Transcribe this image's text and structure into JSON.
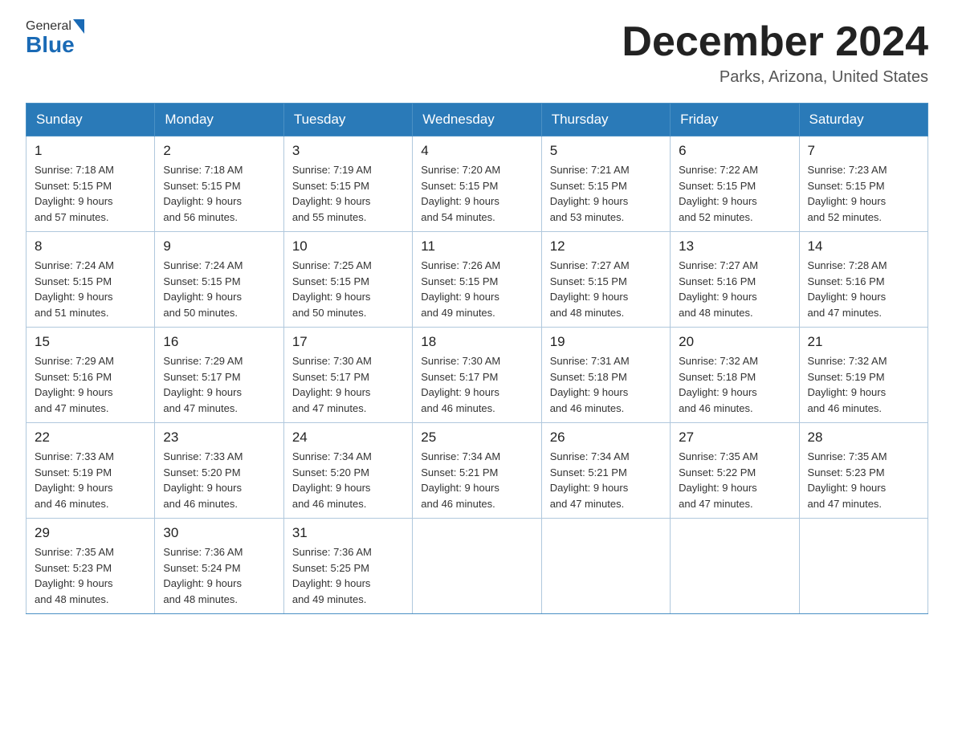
{
  "logo": {
    "general": "General",
    "blue": "Blue"
  },
  "title": {
    "month": "December 2024",
    "location": "Parks, Arizona, United States"
  },
  "days_of_week": [
    "Sunday",
    "Monday",
    "Tuesday",
    "Wednesday",
    "Thursday",
    "Friday",
    "Saturday"
  ],
  "weeks": [
    [
      {
        "day": "1",
        "sunrise": "7:18 AM",
        "sunset": "5:15 PM",
        "daylight": "9 hours and 57 minutes."
      },
      {
        "day": "2",
        "sunrise": "7:18 AM",
        "sunset": "5:15 PM",
        "daylight": "9 hours and 56 minutes."
      },
      {
        "day": "3",
        "sunrise": "7:19 AM",
        "sunset": "5:15 PM",
        "daylight": "9 hours and 55 minutes."
      },
      {
        "day": "4",
        "sunrise": "7:20 AM",
        "sunset": "5:15 PM",
        "daylight": "9 hours and 54 minutes."
      },
      {
        "day": "5",
        "sunrise": "7:21 AM",
        "sunset": "5:15 PM",
        "daylight": "9 hours and 53 minutes."
      },
      {
        "day": "6",
        "sunrise": "7:22 AM",
        "sunset": "5:15 PM",
        "daylight": "9 hours and 52 minutes."
      },
      {
        "day": "7",
        "sunrise": "7:23 AM",
        "sunset": "5:15 PM",
        "daylight": "9 hours and 52 minutes."
      }
    ],
    [
      {
        "day": "8",
        "sunrise": "7:24 AM",
        "sunset": "5:15 PM",
        "daylight": "9 hours and 51 minutes."
      },
      {
        "day": "9",
        "sunrise": "7:24 AM",
        "sunset": "5:15 PM",
        "daylight": "9 hours and 50 minutes."
      },
      {
        "day": "10",
        "sunrise": "7:25 AM",
        "sunset": "5:15 PM",
        "daylight": "9 hours and 50 minutes."
      },
      {
        "day": "11",
        "sunrise": "7:26 AM",
        "sunset": "5:15 PM",
        "daylight": "9 hours and 49 minutes."
      },
      {
        "day": "12",
        "sunrise": "7:27 AM",
        "sunset": "5:15 PM",
        "daylight": "9 hours and 48 minutes."
      },
      {
        "day": "13",
        "sunrise": "7:27 AM",
        "sunset": "5:16 PM",
        "daylight": "9 hours and 48 minutes."
      },
      {
        "day": "14",
        "sunrise": "7:28 AM",
        "sunset": "5:16 PM",
        "daylight": "9 hours and 47 minutes."
      }
    ],
    [
      {
        "day": "15",
        "sunrise": "7:29 AM",
        "sunset": "5:16 PM",
        "daylight": "9 hours and 47 minutes."
      },
      {
        "day": "16",
        "sunrise": "7:29 AM",
        "sunset": "5:17 PM",
        "daylight": "9 hours and 47 minutes."
      },
      {
        "day": "17",
        "sunrise": "7:30 AM",
        "sunset": "5:17 PM",
        "daylight": "9 hours and 47 minutes."
      },
      {
        "day": "18",
        "sunrise": "7:30 AM",
        "sunset": "5:17 PM",
        "daylight": "9 hours and 46 minutes."
      },
      {
        "day": "19",
        "sunrise": "7:31 AM",
        "sunset": "5:18 PM",
        "daylight": "9 hours and 46 minutes."
      },
      {
        "day": "20",
        "sunrise": "7:32 AM",
        "sunset": "5:18 PM",
        "daylight": "9 hours and 46 minutes."
      },
      {
        "day": "21",
        "sunrise": "7:32 AM",
        "sunset": "5:19 PM",
        "daylight": "9 hours and 46 minutes."
      }
    ],
    [
      {
        "day": "22",
        "sunrise": "7:33 AM",
        "sunset": "5:19 PM",
        "daylight": "9 hours and 46 minutes."
      },
      {
        "day": "23",
        "sunrise": "7:33 AM",
        "sunset": "5:20 PM",
        "daylight": "9 hours and 46 minutes."
      },
      {
        "day": "24",
        "sunrise": "7:34 AM",
        "sunset": "5:20 PM",
        "daylight": "9 hours and 46 minutes."
      },
      {
        "day": "25",
        "sunrise": "7:34 AM",
        "sunset": "5:21 PM",
        "daylight": "9 hours and 46 minutes."
      },
      {
        "day": "26",
        "sunrise": "7:34 AM",
        "sunset": "5:21 PM",
        "daylight": "9 hours and 47 minutes."
      },
      {
        "day": "27",
        "sunrise": "7:35 AM",
        "sunset": "5:22 PM",
        "daylight": "9 hours and 47 minutes."
      },
      {
        "day": "28",
        "sunrise": "7:35 AM",
        "sunset": "5:23 PM",
        "daylight": "9 hours and 47 minutes."
      }
    ],
    [
      {
        "day": "29",
        "sunrise": "7:35 AM",
        "sunset": "5:23 PM",
        "daylight": "9 hours and 48 minutes."
      },
      {
        "day": "30",
        "sunrise": "7:36 AM",
        "sunset": "5:24 PM",
        "daylight": "9 hours and 48 minutes."
      },
      {
        "day": "31",
        "sunrise": "7:36 AM",
        "sunset": "5:25 PM",
        "daylight": "9 hours and 49 minutes."
      },
      null,
      null,
      null,
      null
    ]
  ],
  "labels": {
    "sunrise": "Sunrise:",
    "sunset": "Sunset:",
    "daylight": "Daylight:"
  }
}
